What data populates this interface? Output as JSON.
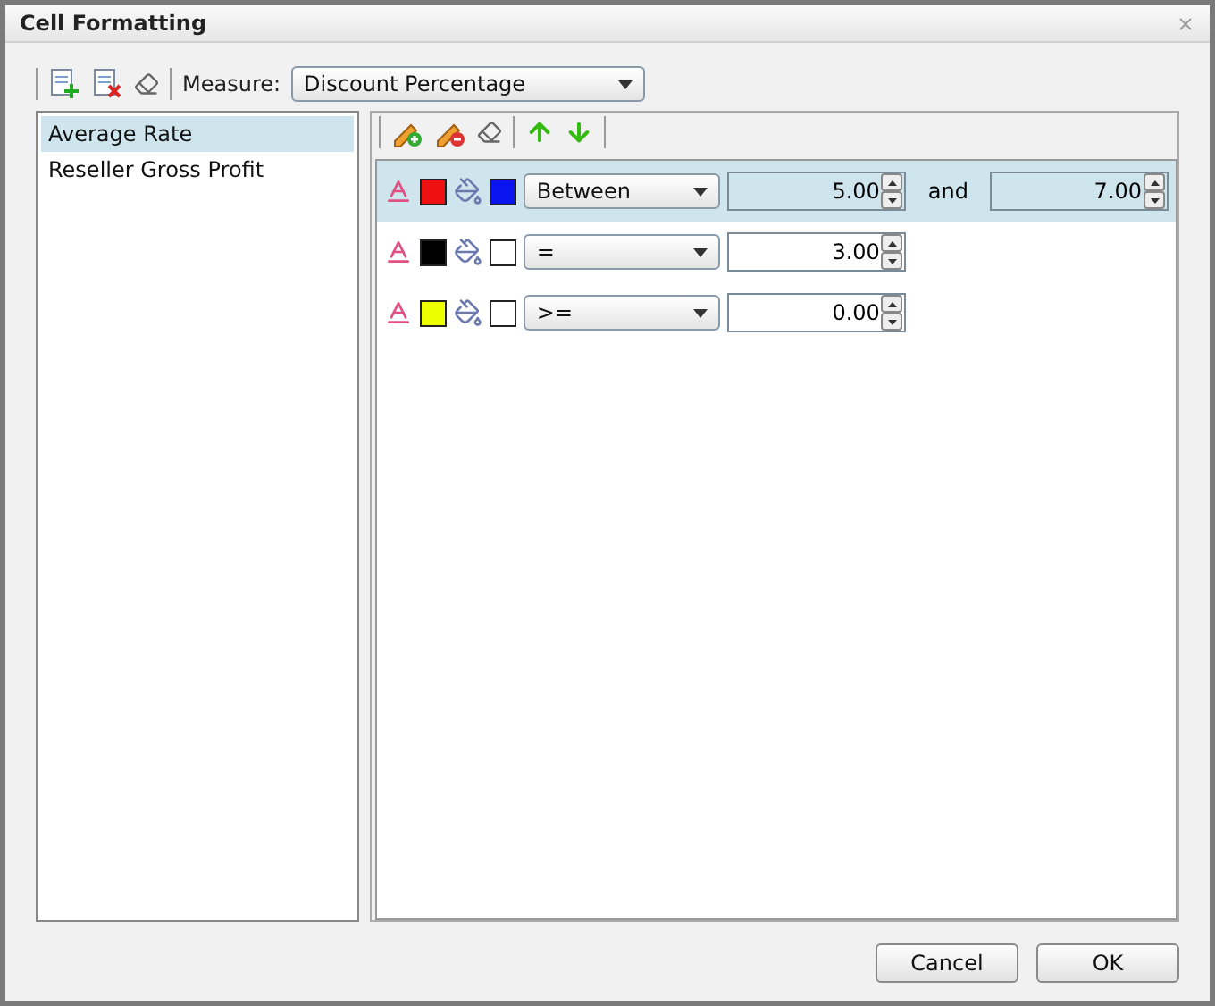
{
  "window": {
    "title": "Cell Formatting"
  },
  "toolbar": {
    "measure_label": "Measure:",
    "measure_value": "Discount Percentage"
  },
  "measures": [
    {
      "label": "Average Rate",
      "selected": true
    },
    {
      "label": "Reseller Gross Profit",
      "selected": false
    }
  ],
  "rules": [
    {
      "kind": "between",
      "font_swatch": {
        "color": "#ee1111"
      },
      "fill_swatch": {
        "color": "#0a14ee"
      },
      "operator": "Between",
      "values": [
        "5.00",
        "7.00"
      ],
      "and_label": "and",
      "selected": true
    },
    {
      "kind": "single",
      "font_swatch": {
        "color": "#000000"
      },
      "fill_swatch": {
        "color": "#ffffff"
      },
      "operator": "=",
      "values": [
        "3.00"
      ],
      "selected": false
    },
    {
      "kind": "single",
      "font_swatch": {
        "color": "#eeff00"
      },
      "fill_swatch": {
        "color": "#ffffff"
      },
      "operator": ">=",
      "values": [
        "0.00"
      ],
      "selected": false
    }
  ],
  "buttons": [
    "Cancel",
    "OK"
  ]
}
